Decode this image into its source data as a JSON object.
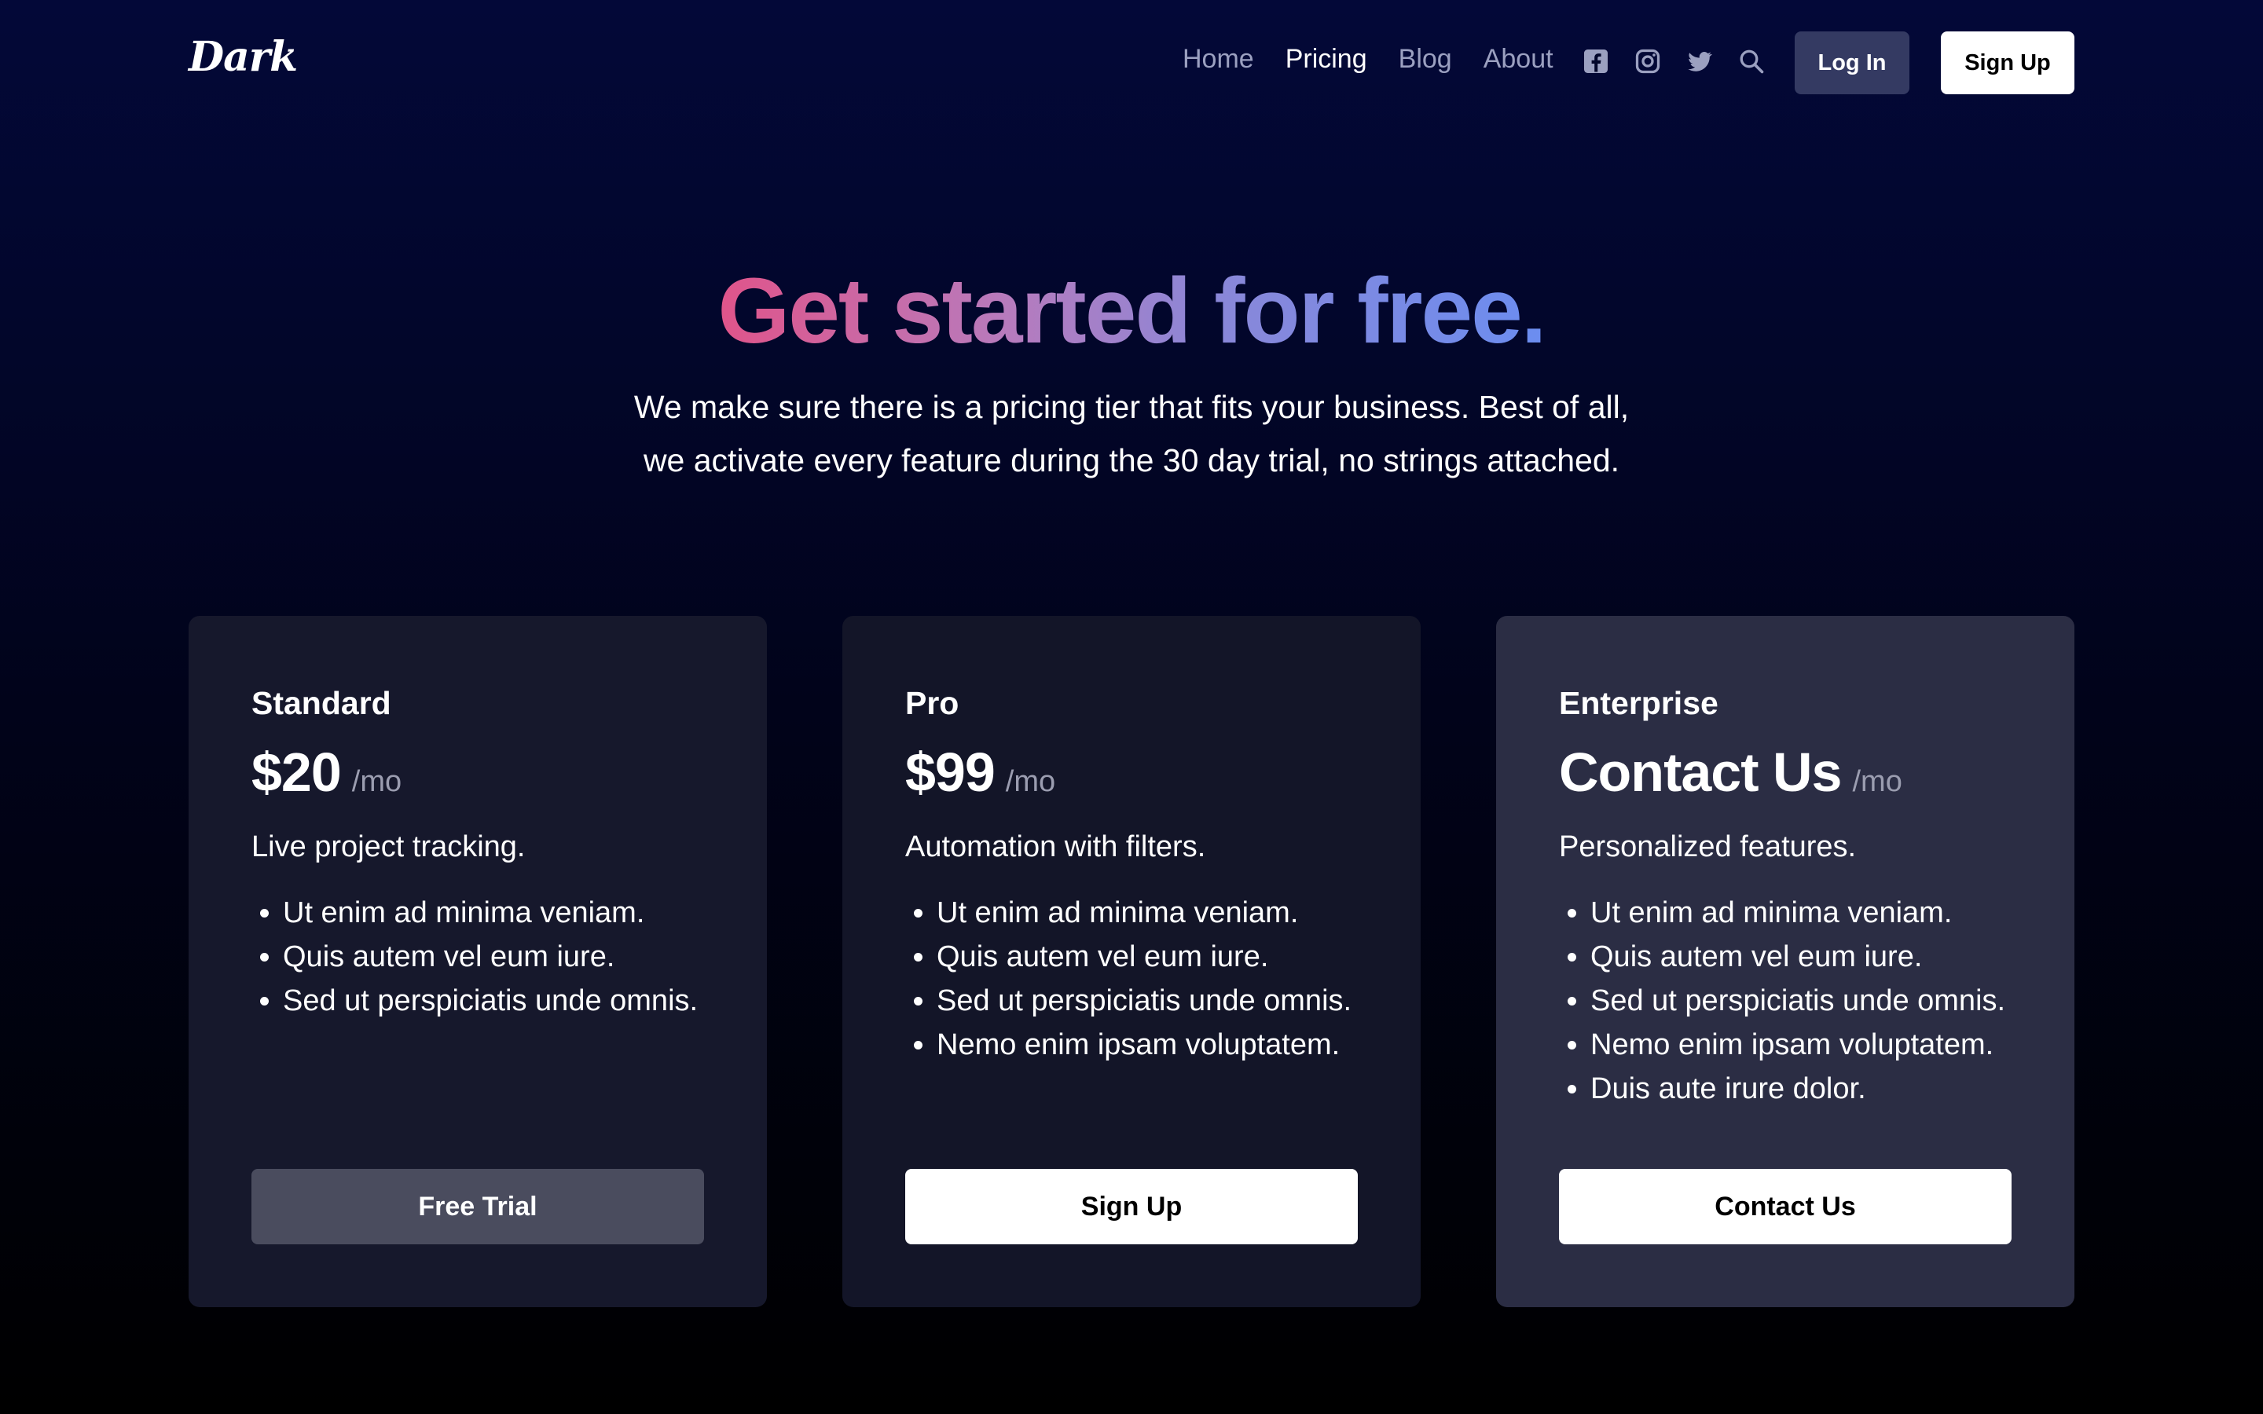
{
  "brand": {
    "logo": "Dark"
  },
  "nav": {
    "links": [
      "Home",
      "Pricing",
      "Blog",
      "About"
    ],
    "active": "Pricing",
    "login_label": "Log In",
    "signup_label": "Sign Up",
    "icons": [
      "facebook-icon",
      "instagram-icon",
      "twitter-icon",
      "search-icon"
    ]
  },
  "hero": {
    "title": "Get started for free.",
    "subtitle_line1": "We make sure there is a pricing tier that fits your business. Best of all,",
    "subtitle_line2": "we activate every feature during the 30 day trial, no strings attached.",
    "gradient_colors": [
      "#e0548a",
      "#b77bbd",
      "#8a87d8",
      "#6b8df0"
    ]
  },
  "plans": [
    {
      "name": "Standard",
      "price": "$20",
      "period": "/mo",
      "tagline": "Live project tracking.",
      "features": [
        "Ut enim ad minima veniam.",
        "Quis autem vel eum iure.",
        "Sed ut perspiciatis unde omnis."
      ],
      "button": "Free Trial"
    },
    {
      "name": "Pro",
      "price": "$99",
      "period": "/mo",
      "tagline": "Automation with filters.",
      "features": [
        "Ut enim ad minima veniam.",
        "Quis autem vel eum iure.",
        "Sed ut perspiciatis unde omnis.",
        "Nemo enim ipsam voluptatem."
      ],
      "button": "Sign Up"
    },
    {
      "name": "Enterprise",
      "price": "Contact Us",
      "period": "/mo",
      "tagline": "Personalized features.",
      "features": [
        "Ut enim ad minima veniam.",
        "Quis autem vel eum iure.",
        "Sed ut perspiciatis unde omnis.",
        "Nemo enim ipsam voluptatem.",
        "Duis aute irure dolor."
      ],
      "button": "Contact Us"
    }
  ]
}
